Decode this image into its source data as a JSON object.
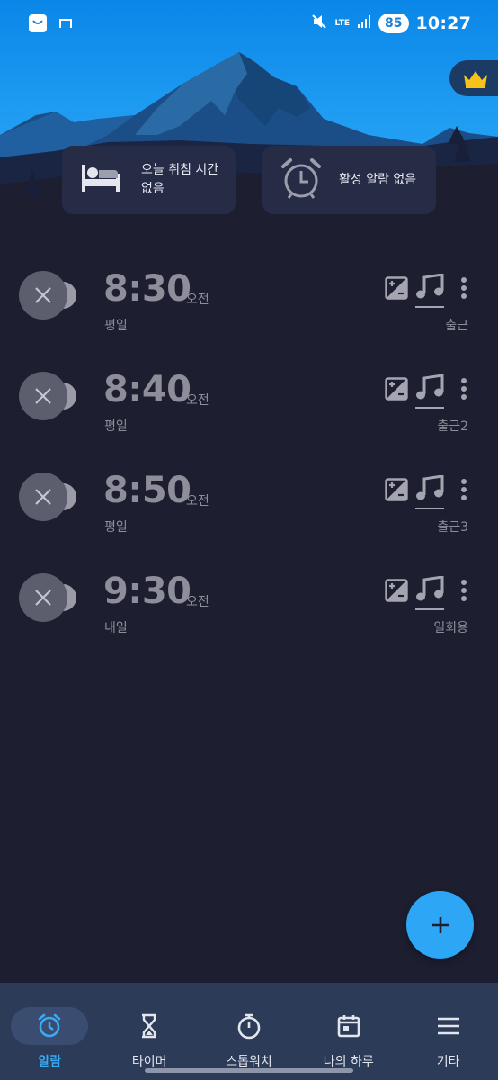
{
  "status_bar": {
    "battery": "85",
    "network": "LTE",
    "time": "10:27"
  },
  "header": {
    "premium_icon": "crown-icon",
    "cards": [
      {
        "icon": "bed-icon",
        "text_line1": "오늘 취침 시간",
        "text_line2": "없음"
      },
      {
        "icon": "alarm-clock-icon",
        "text": "활성 알람 없음"
      }
    ]
  },
  "alarms": [
    {
      "time": "8:30",
      "ampm": "오전",
      "repeat": "평일",
      "label": "출근",
      "enabled": false
    },
    {
      "time": "8:40",
      "ampm": "오전",
      "repeat": "평일",
      "label": "출근2",
      "enabled": false
    },
    {
      "time": "8:50",
      "ampm": "오전",
      "repeat": "평일",
      "label": "출근3",
      "enabled": false
    },
    {
      "time": "9:30",
      "ampm": "오전",
      "repeat": "내일",
      "label": "일회용",
      "enabled": false
    }
  ],
  "fab": {
    "icon": "plus-icon"
  },
  "bottom_nav": [
    {
      "label": "알람",
      "icon": "alarm-icon",
      "active": true
    },
    {
      "label": "타이머",
      "icon": "hourglass-icon",
      "active": false
    },
    {
      "label": "스톱워치",
      "icon": "stopwatch-icon",
      "active": false
    },
    {
      "label": "나의 하루",
      "icon": "calendar-icon",
      "active": false
    },
    {
      "label": "기타",
      "icon": "menu-icon",
      "active": false
    }
  ],
  "colors": {
    "accent": "#2ea6f6",
    "background": "#1d1e30",
    "nav_background": "#2b3b58",
    "disabled_text": "#8d8e99"
  }
}
